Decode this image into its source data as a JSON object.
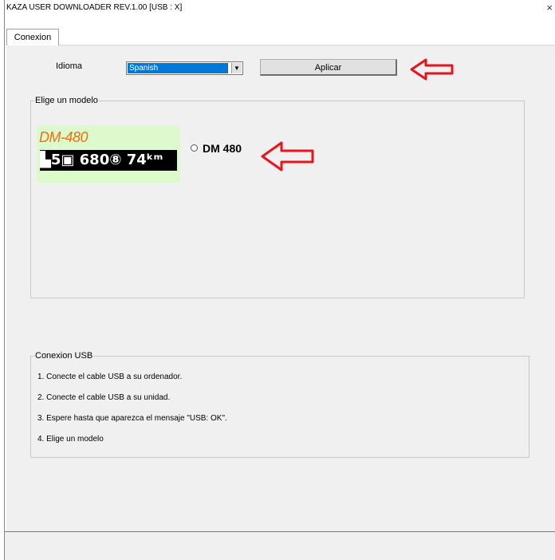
{
  "window": {
    "title": "KAZA USER DOWNLOADER REV.1.00  [USB : X]",
    "close_glyph": "×"
  },
  "tabs": [
    {
      "label": "Conexion"
    }
  ],
  "language": {
    "label": "Idioma",
    "selected": "Spanish",
    "apply_label": "Aplicar"
  },
  "model_group": {
    "legend": "Elige un modelo",
    "display_model_text": "DM-480",
    "display_lcd_text": "▙5▣ 680⑧ 74ᵏᵐ",
    "radio_label": "DM 480"
  },
  "usb_group": {
    "legend": "Conexion USB",
    "steps": [
      "1. Conecte el cable USB a su ordenador.",
      "2. Conecte el cable USB a su unidad.",
      "3. Espere hasta que aparezca el mensaje \"USB: OK\".",
      "4. Elige un modelo"
    ]
  },
  "colors": {
    "annotation_arrow": "#e8141b",
    "selection": "#0078d7",
    "display_bg": "#dcfacc",
    "model_text": "#f07010"
  }
}
